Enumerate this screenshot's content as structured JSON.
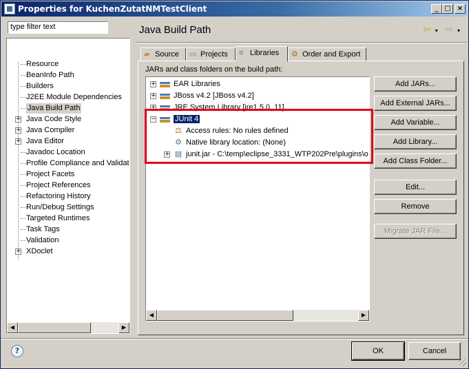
{
  "window": {
    "title": "Properties for KuchenZutatNMTestClient",
    "controls": {
      "minimize": "_",
      "maximize": "□",
      "close": "×"
    }
  },
  "filter": {
    "value": "type filter text"
  },
  "nav_tree": [
    {
      "label": "Resource",
      "expandable": false
    },
    {
      "label": "BeanInfo Path",
      "expandable": false
    },
    {
      "label": "Builders",
      "expandable": false
    },
    {
      "label": "J2EE Module Dependencies",
      "expandable": false
    },
    {
      "label": "Java Build Path",
      "expandable": false,
      "selected": true
    },
    {
      "label": "Java Code Style",
      "expandable": true
    },
    {
      "label": "Java Compiler",
      "expandable": true
    },
    {
      "label": "Java Editor",
      "expandable": true
    },
    {
      "label": "Javadoc Location",
      "expandable": false
    },
    {
      "label": "Profile Compliance and Validatic",
      "expandable": false
    },
    {
      "label": "Project Facets",
      "expandable": false
    },
    {
      "label": "Project References",
      "expandable": false
    },
    {
      "label": "Refactoring History",
      "expandable": false
    },
    {
      "label": "Run/Debug Settings",
      "expandable": false
    },
    {
      "label": "Targeted Runtimes",
      "expandable": false
    },
    {
      "label": "Task Tags",
      "expandable": false
    },
    {
      "label": "Validation",
      "expandable": false
    },
    {
      "label": "XDoclet",
      "expandable": true
    }
  ],
  "page": {
    "title": "Java Build Path"
  },
  "tabs": [
    {
      "label": "Source",
      "icon": "source-folder-icon"
    },
    {
      "label": "Projects",
      "icon": "projects-icon"
    },
    {
      "label": "Libraries",
      "icon": "libraries-icon",
      "active": true
    },
    {
      "label": "Order and Export",
      "icon": "order-export-icon"
    }
  ],
  "libraries": {
    "label": "JARs and class folders on the build path:",
    "tree": [
      {
        "label": "EAR Libraries",
        "level": 0,
        "expander": "+"
      },
      {
        "label": "JBoss v4.2 [JBoss v4.2]",
        "level": 0,
        "expander": "+"
      },
      {
        "label": "JRE System Library [jre1.5.0_11]",
        "level": 0,
        "expander": "+"
      },
      {
        "label": "JUnit 4",
        "level": 0,
        "expander": "−",
        "selected": true
      },
      {
        "label": "Access rules: No rules defined",
        "level": 1,
        "kind": "rule"
      },
      {
        "label": "Native library location: (None)",
        "level": 1,
        "kind": "native"
      },
      {
        "label": "junit.jar - C:\\temp\\eclipse_3331_WTP202Pre\\plugins\\o",
        "level": 1,
        "kind": "jar",
        "expander": "+"
      }
    ],
    "buttons": {
      "add_jars": "Add JARs...",
      "add_external_jars": "Add External JARs...",
      "add_variable": "Add Variable...",
      "add_library": "Add Library...",
      "add_class_folder": "Add Class Folder...",
      "edit": "Edit...",
      "remove": "Remove",
      "migrate_jar": "Migrate JAR File..."
    }
  },
  "dialog": {
    "ok": "OK",
    "cancel": "Cancel",
    "help": "?"
  },
  "colors": {
    "highlight_box": "#e0001c",
    "selection": "#0a246a",
    "title_bar": "#0a246a"
  }
}
